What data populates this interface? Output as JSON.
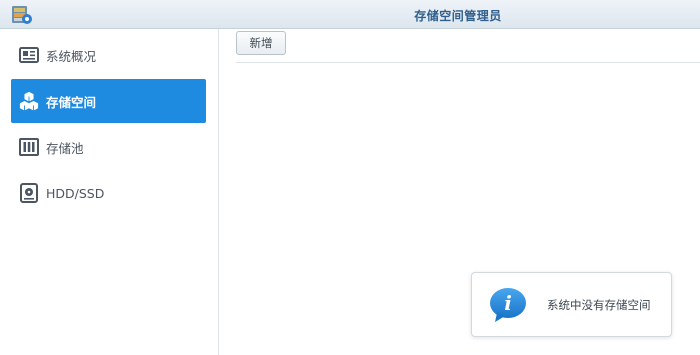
{
  "window": {
    "title": "存储空间管理员"
  },
  "sidebar": {
    "items": [
      {
        "label": "系统概况",
        "icon": "overview-card-icon",
        "active": false
      },
      {
        "label": "存储空间",
        "icon": "cubes-icon",
        "active": true
      },
      {
        "label": "存储池",
        "icon": "storage-pool-icon",
        "active": false
      },
      {
        "label": "HDD/SSD",
        "icon": "hard-drive-icon",
        "active": false
      }
    ]
  },
  "toolbar": {
    "create_label": "新增"
  },
  "notice": {
    "message": "系统中没有存储空间",
    "icon": "info-bubble-icon"
  },
  "colors": {
    "accent": "#1e8ae0",
    "title": "#2f5f8c",
    "info": "#1c86d8"
  }
}
